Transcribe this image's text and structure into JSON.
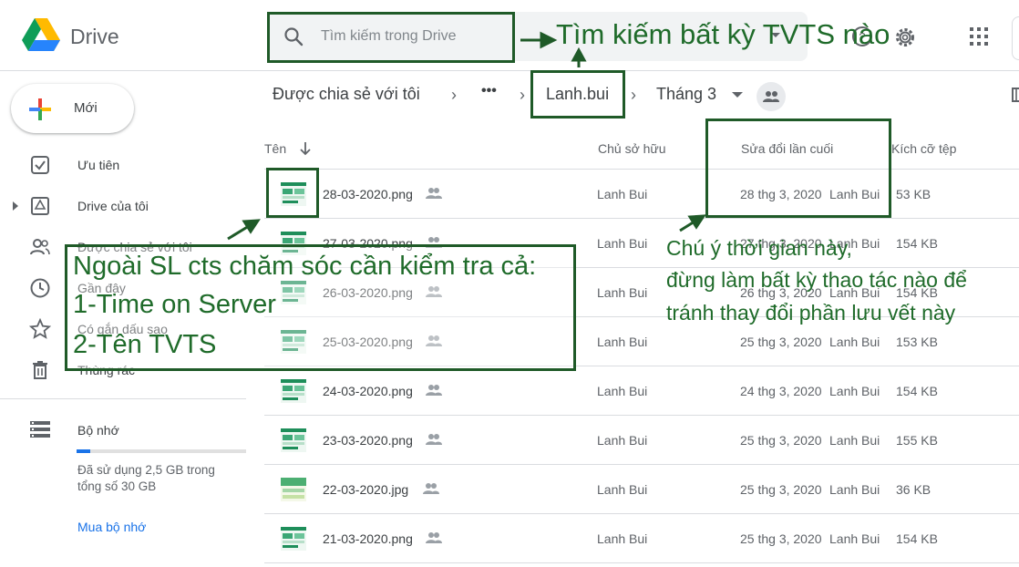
{
  "header": {
    "brand": "Drive",
    "search_placeholder": "Tìm kiếm trong Drive"
  },
  "sidebar": {
    "new_label": "Mới",
    "items": [
      {
        "label": "Ưu tiên",
        "icon": "priority-icon"
      },
      {
        "label": "Drive của tôi",
        "icon": "my-drive-icon"
      },
      {
        "label": "Được chia sẻ với tôi",
        "icon": "shared-with-me-icon"
      },
      {
        "label": "Gần đây",
        "icon": "clock-icon"
      },
      {
        "label": "Có gắn dấu sao",
        "icon": "star-icon"
      },
      {
        "label": "Thùng rác",
        "icon": "trash-icon"
      }
    ],
    "storage": {
      "title": "Bộ nhớ",
      "used_fraction": 0.083,
      "text": "Đã sử dụng 2,5 GB trong tổng số 30 GB",
      "buy_label": "Mua bộ nhớ"
    }
  },
  "breadcrumb": {
    "root": "Được chia sẻ với tôi",
    "more": "•••",
    "folder1": "Lanh.bui",
    "folder2": "Tháng 3",
    "separator": "›"
  },
  "columns": {
    "name": "Tên",
    "owner": "Chủ sở hữu",
    "modified": "Sửa đổi lần cuối",
    "size": "Kích cỡ tệp"
  },
  "files": [
    {
      "name": "28-03-2020.png",
      "owner": "Lanh Bui",
      "modified": "28 thg 3, 2020",
      "modified_by": "Lanh Bui",
      "size": "53 KB"
    },
    {
      "name": "27-03-2020.png",
      "owner": "Lanh Bui",
      "modified": "27 thg 3, 2020",
      "modified_by": "Lanh Bui",
      "size": "154 KB"
    },
    {
      "name": "26-03-2020.png",
      "owner": "Lanh Bui",
      "modified": "26 thg 3, 2020",
      "modified_by": "Lanh Bui",
      "size": "154 KB"
    },
    {
      "name": "25-03-2020.png",
      "owner": "Lanh Bui",
      "modified": "25 thg 3, 2020",
      "modified_by": "Lanh Bui",
      "size": "153 KB"
    },
    {
      "name": "24-03-2020.png",
      "owner": "Lanh Bui",
      "modified": "24 thg 3, 2020",
      "modified_by": "Lanh Bui",
      "size": "154 KB"
    },
    {
      "name": "23-03-2020.png",
      "owner": "Lanh Bui",
      "modified": "25 thg 3, 2020",
      "modified_by": "Lanh Bui",
      "size": "155 KB"
    },
    {
      "name": "22-03-2020.jpg",
      "owner": "Lanh Bui",
      "modified": "25 thg 3, 2020",
      "modified_by": "Lanh Bui",
      "size": "36 KB"
    },
    {
      "name": "21-03-2020.png",
      "owner": "Lanh Bui",
      "modified": "25 thg 3, 2020",
      "modified_by": "Lanh Bui",
      "size": "154 KB"
    }
  ],
  "annotations": {
    "search_note": "Tìm kiếm bất kỳ TVTS nào",
    "check_line1": "Ngoài SL cts chăm sóc cần kiểm tra cả:",
    "check_line2": "1-Time on Server",
    "check_line3": "2-Tên TVTS",
    "time_line1": "Chú ý thời gian này,",
    "time_line2": "đừng làm bất kỳ thao tác nào để",
    "time_line3": "tránh thay đổi phần lưu vết này"
  },
  "colors": {
    "annotation": "#1f5a28",
    "accent": "#1a73e8"
  }
}
